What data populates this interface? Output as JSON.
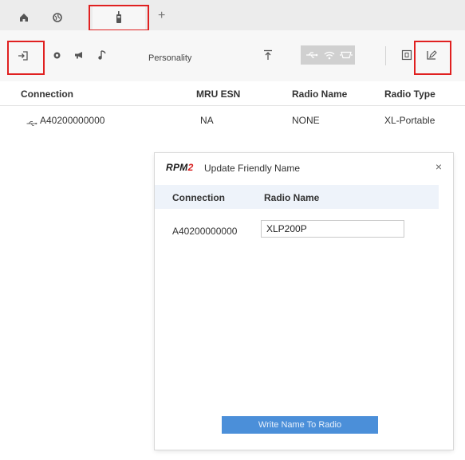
{
  "tabs": {
    "home": {
      "icon": "home-icon"
    },
    "network": {
      "icon": "globe-icon"
    },
    "radio": {
      "icon": "radio-icon"
    },
    "add": {
      "label": "+"
    }
  },
  "toolbar": {
    "personality_label": "Personality"
  },
  "table": {
    "columns": [
      "Connection",
      "MRU ESN",
      "Radio Name",
      "Radio Type"
    ],
    "rows": [
      {
        "connection": "A40200000000",
        "mru_esn": "NA",
        "radio_name": "NONE",
        "radio_type": "XL-Portable"
      }
    ]
  },
  "dialog": {
    "brand_main": "RPM",
    "brand_accent": "2",
    "title": "Update Friendly Name",
    "close_label": "×",
    "columns": [
      "Connection",
      "Radio Name"
    ],
    "row": {
      "connection": "A40200000000",
      "radio_name": "XLP200P"
    },
    "button_label": "Write Name To Radio"
  },
  "colors": {
    "highlight": "#e02020",
    "button": "#4b8fd9",
    "brand_accent": "#d71f1f",
    "dialog_header_row": "#eef3fa"
  }
}
